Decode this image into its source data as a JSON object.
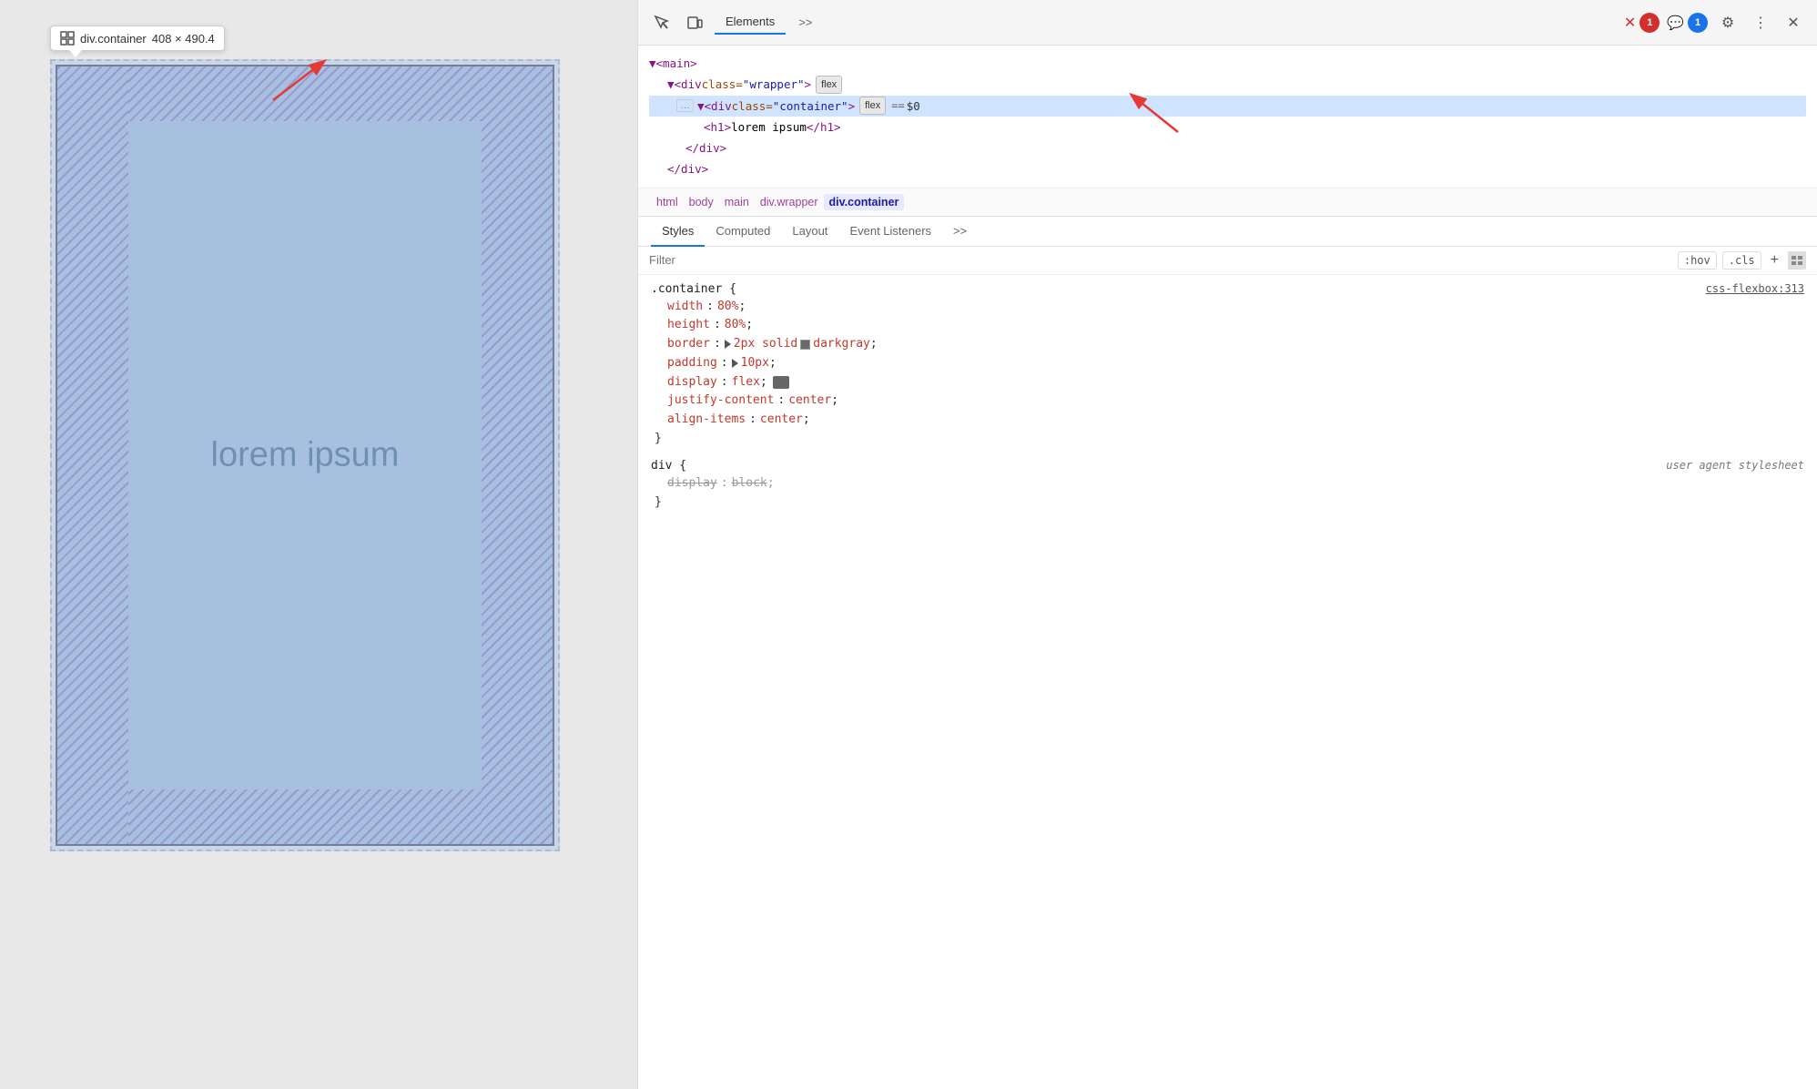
{
  "preview": {
    "tooltip": {
      "class_name": "div.container",
      "dimensions": "408 × 490.4"
    },
    "element_text": "lorem ipsum"
  },
  "devtools": {
    "header": {
      "tabs": [
        {
          "label": "Elements",
          "active": true
        },
        {
          "label": ">>",
          "active": false
        }
      ],
      "badges": {
        "errors": "1",
        "messages": "1"
      }
    },
    "dom_tree": {
      "lines": [
        {
          "indent": 0,
          "content": "▼<main>"
        },
        {
          "indent": 1,
          "content": "▼<div class=\"wrapper\">",
          "badge": "flex"
        },
        {
          "indent": 2,
          "content": "▼<div class=\"container\">",
          "badge": "flex",
          "selected": true,
          "suffix": "== $0"
        },
        {
          "indent": 3,
          "content": "<h1>lorem ipsum</h1>"
        },
        {
          "indent": 2,
          "content": "</div>"
        },
        {
          "indent": 1,
          "content": "</div>"
        }
      ]
    },
    "breadcrumbs": [
      "html",
      "body",
      "main",
      "div.wrapper",
      "div.container"
    ],
    "sub_tabs": [
      "Styles",
      "Computed",
      "Layout",
      "Event Listeners",
      ">>"
    ],
    "filter": {
      "placeholder": "Filter",
      "tools": [
        ":hov",
        ".cls"
      ]
    },
    "css_rules": [
      {
        "selector": ".container {",
        "source": "css-flexbox:313",
        "properties": [
          {
            "name": "width",
            "value": "80%",
            "struck": false
          },
          {
            "name": "height",
            "value": "80%",
            "struck": false
          },
          {
            "name": "border",
            "value": "2px solid",
            "color_swatch": "#696969",
            "color_name": "darkgray",
            "has_triangle": true,
            "struck": false
          },
          {
            "name": "padding",
            "value": "10px",
            "has_triangle": true,
            "struck": false
          },
          {
            "name": "display",
            "value": "flex",
            "has_flex_icon": true,
            "struck": false
          },
          {
            "name": "justify-content",
            "value": "center",
            "struck": false
          },
          {
            "name": "align-items",
            "value": "center",
            "struck": false
          }
        ],
        "close": "}"
      },
      {
        "selector": "div {",
        "source_italic": "user agent stylesheet",
        "properties": [
          {
            "name": "display",
            "value": "block",
            "struck": true
          }
        ],
        "close": "}"
      }
    ]
  }
}
